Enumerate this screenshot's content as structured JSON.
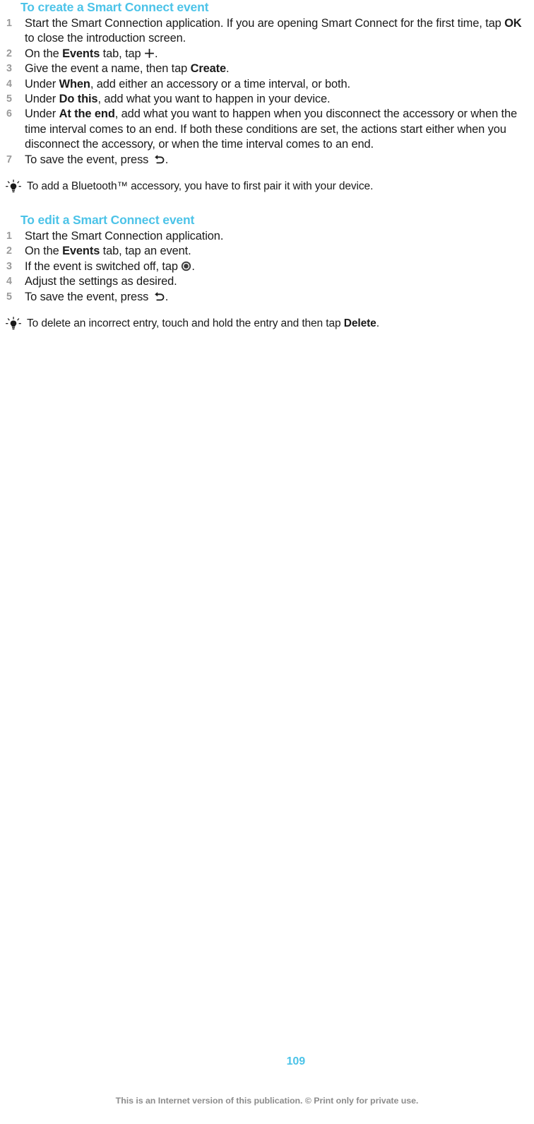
{
  "document": {
    "page_number": "109",
    "footer_note": "This is an Internet version of this publication. © Print only for private use.",
    "heading_color": "#4cc3e8",
    "body_color": "#1a1a1a",
    "number_color": "#9a9a9a",
    "footer_color": "#8c8c8c"
  },
  "sections": [
    {
      "heading": "To create a Smart Connect event",
      "steps": [
        {
          "number": "1",
          "parts": [
            {
              "type": "text",
              "value": "Start the Smart Connection application. If you are opening Smart Connect for the first time, tap "
            },
            {
              "type": "bold",
              "value": "OK"
            },
            {
              "type": "text",
              "value": " to close the introduction screen."
            }
          ]
        },
        {
          "number": "2",
          "parts": [
            {
              "type": "text",
              "value": "On the "
            },
            {
              "type": "bold",
              "value": "Events"
            },
            {
              "type": "text",
              "value": " tab, tap "
            },
            {
              "type": "icon",
              "value": "plus-icon"
            },
            {
              "type": "text",
              "value": "."
            }
          ]
        },
        {
          "number": "3",
          "parts": [
            {
              "type": "text",
              "value": "Give the event a name, then tap "
            },
            {
              "type": "bold",
              "value": "Create"
            },
            {
              "type": "text",
              "value": "."
            }
          ]
        },
        {
          "number": "4",
          "parts": [
            {
              "type": "text",
              "value": "Under "
            },
            {
              "type": "bold",
              "value": "When"
            },
            {
              "type": "text",
              "value": ", add either an accessory or a time interval, or both."
            }
          ]
        },
        {
          "number": "5",
          "parts": [
            {
              "type": "text",
              "value": "Under "
            },
            {
              "type": "bold",
              "value": "Do this"
            },
            {
              "type": "text",
              "value": ", add what you want to happen in your device."
            }
          ]
        },
        {
          "number": "6",
          "parts": [
            {
              "type": "text",
              "value": "Under "
            },
            {
              "type": "bold",
              "value": "At the end"
            },
            {
              "type": "text",
              "value": ", add what you want to happen when you disconnect the accessory or when the time interval comes to an end. If both these conditions are set, the actions start either when you disconnect the accessory, or when the time interval comes to an end."
            }
          ]
        },
        {
          "number": "7",
          "parts": [
            {
              "type": "text",
              "value": "To save the event, press "
            },
            {
              "type": "icon",
              "value": "back-arrow-icon"
            },
            {
              "type": "text",
              "value": "."
            }
          ]
        }
      ],
      "tip": {
        "icon": "lightbulb-tip-icon",
        "parts": [
          {
            "type": "text",
            "value": "To add a Bluetooth™ accessory, you have to first pair it with your device."
          }
        ]
      }
    },
    {
      "heading": "To edit a Smart Connect event",
      "steps": [
        {
          "number": "1",
          "parts": [
            {
              "type": "text",
              "value": "Start the Smart Connection application."
            }
          ]
        },
        {
          "number": "2",
          "parts": [
            {
              "type": "text",
              "value": "On the "
            },
            {
              "type": "bold",
              "value": "Events"
            },
            {
              "type": "text",
              "value": " tab, tap an event."
            }
          ]
        },
        {
          "number": "3",
          "parts": [
            {
              "type": "text",
              "value": "If the event is switched off, tap "
            },
            {
              "type": "icon",
              "value": "power-toggle-icon"
            },
            {
              "type": "text",
              "value": "."
            }
          ]
        },
        {
          "number": "4",
          "parts": [
            {
              "type": "text",
              "value": "Adjust the settings as desired."
            }
          ]
        },
        {
          "number": "5",
          "parts": [
            {
              "type": "text",
              "value": "To save the event, press "
            },
            {
              "type": "icon",
              "value": "back-arrow-icon"
            },
            {
              "type": "text",
              "value": "."
            }
          ]
        }
      ],
      "tip": {
        "icon": "lightbulb-tip-icon",
        "parts": [
          {
            "type": "text",
            "value": "To delete an incorrect entry, touch and hold the entry and then tap "
          },
          {
            "type": "bold",
            "value": "Delete"
          },
          {
            "type": "text",
            "value": "."
          }
        ]
      }
    }
  ]
}
